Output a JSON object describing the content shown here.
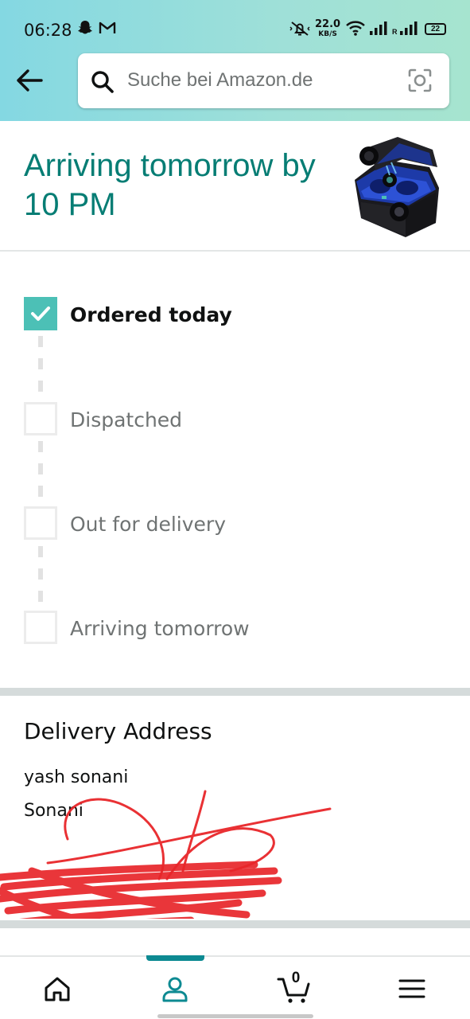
{
  "status_bar": {
    "time": "06:28",
    "net_speed_value": "22.0",
    "net_speed_unit": "KB/S",
    "roaming_label": "R",
    "battery": "22"
  },
  "search": {
    "placeholder": "Suche bei Amazon.de"
  },
  "arrival": {
    "title": "Arriving tomorrow by 10 PM",
    "product_image": "blue wireless earbuds in charging case"
  },
  "tracker": {
    "steps": [
      {
        "label": "Ordered today",
        "completed": true
      },
      {
        "label": "Dispatched",
        "completed": false
      },
      {
        "label": "Out for delivery",
        "completed": false
      },
      {
        "label": "Arriving tomorrow",
        "completed": false
      }
    ]
  },
  "address": {
    "title": "Delivery Address",
    "lines": [
      "yash sonani",
      "Sonani"
    ],
    "redaction_color": "#e8262a"
  },
  "bottom_nav": {
    "items": [
      "home-icon",
      "account-icon",
      "cart-icon",
      "menu-icon"
    ],
    "active": "account",
    "cart_count": "0",
    "accent": "#0d8a92"
  },
  "colors": {
    "header_gradient_start": "#84d8e2",
    "header_gradient_end": "#a6e4cf",
    "title_teal": "#067d74",
    "check_teal": "#4cc0b6"
  }
}
